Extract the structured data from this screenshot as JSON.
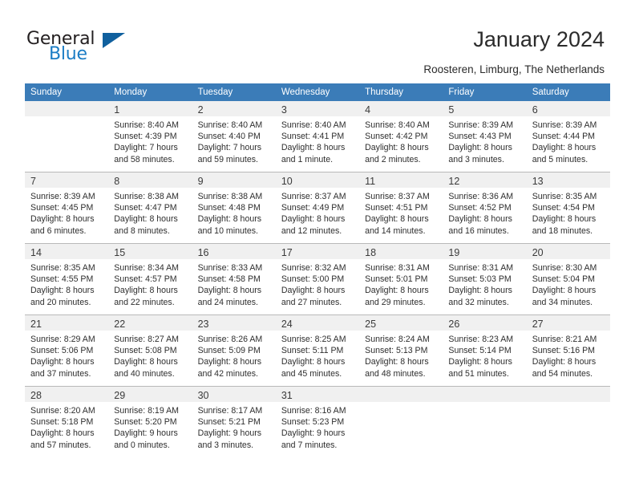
{
  "brand": {
    "name_primary": "General",
    "name_secondary": "Blue",
    "triangle_color": "#10609e",
    "blue_color": "#1c7dc5"
  },
  "header": {
    "title": "January 2024",
    "subtitle": "Roosteren, Limburg, The Netherlands",
    "header_bg": "#3b7cb8",
    "daynum_bg": "#f0f0f0"
  },
  "weekday_headers": [
    "Sunday",
    "Monday",
    "Tuesday",
    "Wednesday",
    "Thursday",
    "Friday",
    "Saturday"
  ],
  "weeks": [
    [
      {
        "day": "",
        "sunrise": "",
        "sunset": "",
        "daylight_line1": "",
        "daylight_line2": ""
      },
      {
        "day": "1",
        "sunrise": "Sunrise: 8:40 AM",
        "sunset": "Sunset: 4:39 PM",
        "daylight_line1": "Daylight: 7 hours",
        "daylight_line2": "and 58 minutes."
      },
      {
        "day": "2",
        "sunrise": "Sunrise: 8:40 AM",
        "sunset": "Sunset: 4:40 PM",
        "daylight_line1": "Daylight: 7 hours",
        "daylight_line2": "and 59 minutes."
      },
      {
        "day": "3",
        "sunrise": "Sunrise: 8:40 AM",
        "sunset": "Sunset: 4:41 PM",
        "daylight_line1": "Daylight: 8 hours",
        "daylight_line2": "and 1 minute."
      },
      {
        "day": "4",
        "sunrise": "Sunrise: 8:40 AM",
        "sunset": "Sunset: 4:42 PM",
        "daylight_line1": "Daylight: 8 hours",
        "daylight_line2": "and 2 minutes."
      },
      {
        "day": "5",
        "sunrise": "Sunrise: 8:39 AM",
        "sunset": "Sunset: 4:43 PM",
        "daylight_line1": "Daylight: 8 hours",
        "daylight_line2": "and 3 minutes."
      },
      {
        "day": "6",
        "sunrise": "Sunrise: 8:39 AM",
        "sunset": "Sunset: 4:44 PM",
        "daylight_line1": "Daylight: 8 hours",
        "daylight_line2": "and 5 minutes."
      }
    ],
    [
      {
        "day": "7",
        "sunrise": "Sunrise: 8:39 AM",
        "sunset": "Sunset: 4:45 PM",
        "daylight_line1": "Daylight: 8 hours",
        "daylight_line2": "and 6 minutes."
      },
      {
        "day": "8",
        "sunrise": "Sunrise: 8:38 AM",
        "sunset": "Sunset: 4:47 PM",
        "daylight_line1": "Daylight: 8 hours",
        "daylight_line2": "and 8 minutes."
      },
      {
        "day": "9",
        "sunrise": "Sunrise: 8:38 AM",
        "sunset": "Sunset: 4:48 PM",
        "daylight_line1": "Daylight: 8 hours",
        "daylight_line2": "and 10 minutes."
      },
      {
        "day": "10",
        "sunrise": "Sunrise: 8:37 AM",
        "sunset": "Sunset: 4:49 PM",
        "daylight_line1": "Daylight: 8 hours",
        "daylight_line2": "and 12 minutes."
      },
      {
        "day": "11",
        "sunrise": "Sunrise: 8:37 AM",
        "sunset": "Sunset: 4:51 PM",
        "daylight_line1": "Daylight: 8 hours",
        "daylight_line2": "and 14 minutes."
      },
      {
        "day": "12",
        "sunrise": "Sunrise: 8:36 AM",
        "sunset": "Sunset: 4:52 PM",
        "daylight_line1": "Daylight: 8 hours",
        "daylight_line2": "and 16 minutes."
      },
      {
        "day": "13",
        "sunrise": "Sunrise: 8:35 AM",
        "sunset": "Sunset: 4:54 PM",
        "daylight_line1": "Daylight: 8 hours",
        "daylight_line2": "and 18 minutes."
      }
    ],
    [
      {
        "day": "14",
        "sunrise": "Sunrise: 8:35 AM",
        "sunset": "Sunset: 4:55 PM",
        "daylight_line1": "Daylight: 8 hours",
        "daylight_line2": "and 20 minutes."
      },
      {
        "day": "15",
        "sunrise": "Sunrise: 8:34 AM",
        "sunset": "Sunset: 4:57 PM",
        "daylight_line1": "Daylight: 8 hours",
        "daylight_line2": "and 22 minutes."
      },
      {
        "day": "16",
        "sunrise": "Sunrise: 8:33 AM",
        "sunset": "Sunset: 4:58 PM",
        "daylight_line1": "Daylight: 8 hours",
        "daylight_line2": "and 24 minutes."
      },
      {
        "day": "17",
        "sunrise": "Sunrise: 8:32 AM",
        "sunset": "Sunset: 5:00 PM",
        "daylight_line1": "Daylight: 8 hours",
        "daylight_line2": "and 27 minutes."
      },
      {
        "day": "18",
        "sunrise": "Sunrise: 8:31 AM",
        "sunset": "Sunset: 5:01 PM",
        "daylight_line1": "Daylight: 8 hours",
        "daylight_line2": "and 29 minutes."
      },
      {
        "day": "19",
        "sunrise": "Sunrise: 8:31 AM",
        "sunset": "Sunset: 5:03 PM",
        "daylight_line1": "Daylight: 8 hours",
        "daylight_line2": "and 32 minutes."
      },
      {
        "day": "20",
        "sunrise": "Sunrise: 8:30 AM",
        "sunset": "Sunset: 5:04 PM",
        "daylight_line1": "Daylight: 8 hours",
        "daylight_line2": "and 34 minutes."
      }
    ],
    [
      {
        "day": "21",
        "sunrise": "Sunrise: 8:29 AM",
        "sunset": "Sunset: 5:06 PM",
        "daylight_line1": "Daylight: 8 hours",
        "daylight_line2": "and 37 minutes."
      },
      {
        "day": "22",
        "sunrise": "Sunrise: 8:27 AM",
        "sunset": "Sunset: 5:08 PM",
        "daylight_line1": "Daylight: 8 hours",
        "daylight_line2": "and 40 minutes."
      },
      {
        "day": "23",
        "sunrise": "Sunrise: 8:26 AM",
        "sunset": "Sunset: 5:09 PM",
        "daylight_line1": "Daylight: 8 hours",
        "daylight_line2": "and 42 minutes."
      },
      {
        "day": "24",
        "sunrise": "Sunrise: 8:25 AM",
        "sunset": "Sunset: 5:11 PM",
        "daylight_line1": "Daylight: 8 hours",
        "daylight_line2": "and 45 minutes."
      },
      {
        "day": "25",
        "sunrise": "Sunrise: 8:24 AM",
        "sunset": "Sunset: 5:13 PM",
        "daylight_line1": "Daylight: 8 hours",
        "daylight_line2": "and 48 minutes."
      },
      {
        "day": "26",
        "sunrise": "Sunrise: 8:23 AM",
        "sunset": "Sunset: 5:14 PM",
        "daylight_line1": "Daylight: 8 hours",
        "daylight_line2": "and 51 minutes."
      },
      {
        "day": "27",
        "sunrise": "Sunrise: 8:21 AM",
        "sunset": "Sunset: 5:16 PM",
        "daylight_line1": "Daylight: 8 hours",
        "daylight_line2": "and 54 minutes."
      }
    ],
    [
      {
        "day": "28",
        "sunrise": "Sunrise: 8:20 AM",
        "sunset": "Sunset: 5:18 PM",
        "daylight_line1": "Daylight: 8 hours",
        "daylight_line2": "and 57 minutes."
      },
      {
        "day": "29",
        "sunrise": "Sunrise: 8:19 AM",
        "sunset": "Sunset: 5:20 PM",
        "daylight_line1": "Daylight: 9 hours",
        "daylight_line2": "and 0 minutes."
      },
      {
        "day": "30",
        "sunrise": "Sunrise: 8:17 AM",
        "sunset": "Sunset: 5:21 PM",
        "daylight_line1": "Daylight: 9 hours",
        "daylight_line2": "and 3 minutes."
      },
      {
        "day": "31",
        "sunrise": "Sunrise: 8:16 AM",
        "sunset": "Sunset: 5:23 PM",
        "daylight_line1": "Daylight: 9 hours",
        "daylight_line2": "and 7 minutes."
      },
      {
        "day": "",
        "sunrise": "",
        "sunset": "",
        "daylight_line1": "",
        "daylight_line2": ""
      },
      {
        "day": "",
        "sunrise": "",
        "sunset": "",
        "daylight_line1": "",
        "daylight_line2": ""
      },
      {
        "day": "",
        "sunrise": "",
        "sunset": "",
        "daylight_line1": "",
        "daylight_line2": ""
      }
    ]
  ]
}
